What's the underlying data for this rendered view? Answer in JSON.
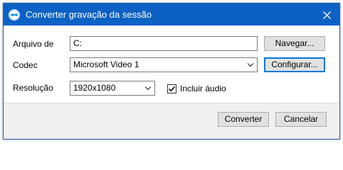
{
  "window": {
    "title": "Converter gravação da sessão",
    "accent_color": "#0c62c4",
    "icon": "teamviewer-icon",
    "close_icon": "close-icon"
  },
  "form": {
    "file_label": "Arquivo de",
    "file_value": "C:",
    "browse_label": "Navegar...",
    "codec_label": "Codec",
    "codec_value": "Microsoft Video 1",
    "configure_label": "Configurar...",
    "resolution_label": "Resolução",
    "resolution_value": "1920x1080",
    "include_audio_label": "Incluir áudio",
    "include_audio_checked": true
  },
  "footer": {
    "convert_label": "Converter",
    "cancel_label": "Cancelar"
  }
}
